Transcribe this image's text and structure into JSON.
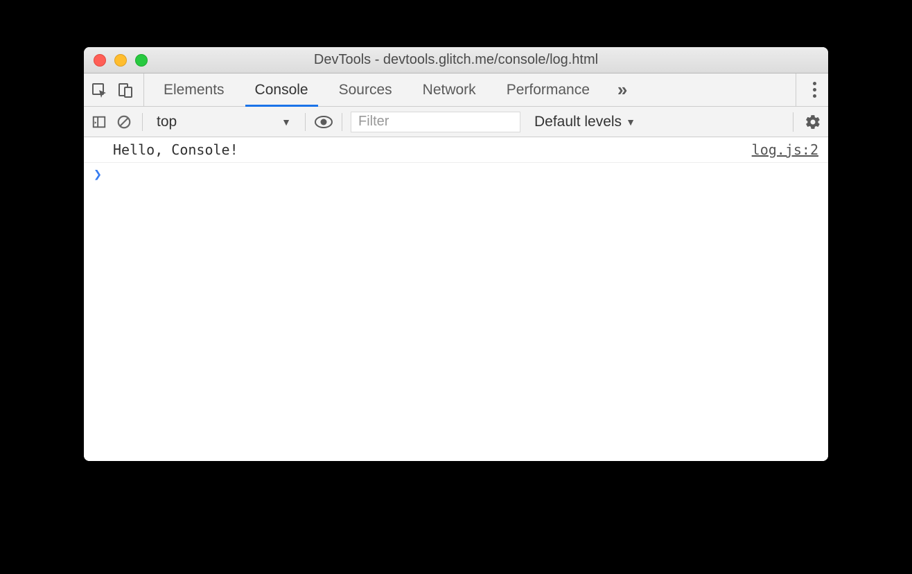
{
  "window": {
    "title": "DevTools - devtools.glitch.me/console/log.html"
  },
  "tabs": {
    "items": [
      "Elements",
      "Console",
      "Sources",
      "Network",
      "Performance"
    ],
    "active_index": 1,
    "overflow_glyph": "»"
  },
  "console_toolbar": {
    "context": "top",
    "filter_placeholder": "Filter",
    "levels_label": "Default levels"
  },
  "console": {
    "logs": [
      {
        "message": "Hello, Console!",
        "source": "log.js:2"
      }
    ],
    "prompt_glyph": "❯"
  }
}
